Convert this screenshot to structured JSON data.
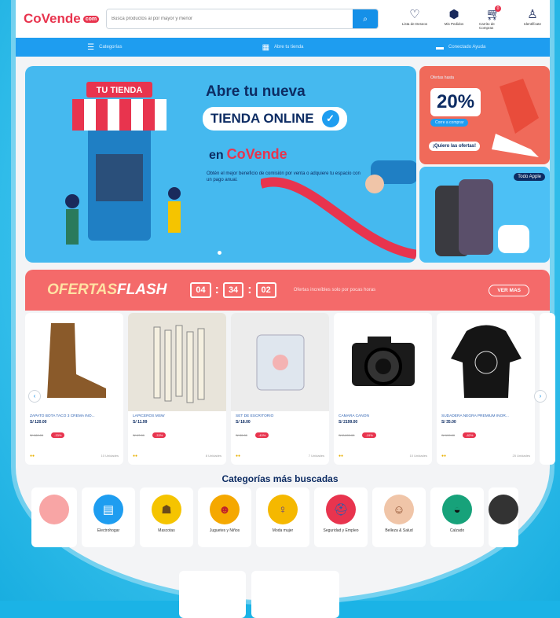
{
  "colors": {
    "brand": "#e8344e",
    "primary": "#1e9df0",
    "navy": "#0d2c63",
    "flash": "#f46a6a"
  },
  "header": {
    "logo": "CoVende",
    "logo_suffix": "com",
    "search": {
      "placeholder": "Busca productos al por mayor y menor",
      "icon": "search-icon"
    },
    "icons": [
      {
        "name": "heart-icon",
        "label": "Lista de Deseos"
      },
      {
        "name": "box-icon",
        "label": "Mis Pedidos"
      },
      {
        "name": "cart-icon",
        "label": "Carrito de Compras",
        "badge": "0"
      },
      {
        "name": "user-icon",
        "label": "Identifícate"
      }
    ]
  },
  "nav": {
    "categories": "Categorías",
    "tienda": "Abre tu tienda",
    "tracking": "Conectado Ayuda"
  },
  "hero": {
    "badge": "TU TIENDA",
    "line1": "Abre tu nueva",
    "line2": "TIENDA ONLINE",
    "en": "en",
    "brand": "CoVende",
    "desc": "Obtén el mejor beneficio de comisión por venta o adquiere tu espacio con un pago anual."
  },
  "side_promo": {
    "pre": "Ofertas hasta",
    "percent": "20%",
    "sub": "Corre a comprar",
    "cta": "¡Quiero las ofertas!"
  },
  "side_apple": {
    "tag": "Todo Apple"
  },
  "flash": {
    "title_a": "OFERTAS",
    "title_b": "FLASH",
    "hh": "04",
    "mm": "34",
    "ss": "02",
    "message": "Ofertas increíbles solo por pocas horas",
    "cta": "VER MAS"
  },
  "products": [
    {
      "name": "ZAPATO BOTA TACO 3 CREMA INO...",
      "price": "S/ 120.00",
      "old": "S/ 180.00",
      "off": "-33%",
      "stock": "10 Unidades"
    },
    {
      "name": "LAPICEROS MSW",
      "price": "S/ 11.99",
      "old": "S/ 17.99",
      "off": "-33%",
      "stock": "8 Unidades"
    },
    {
      "name": "SET DE ESCRITORIO",
      "price": "S/ 18.00",
      "old": "S/ 30.00",
      "off": "-40%",
      "stock": "7 Unidades"
    },
    {
      "name": "CÁMARA CANON",
      "price": "S/ 2199.00",
      "old": "S/ 2,699.00",
      "off": "-19%",
      "stock": "10 Unidades"
    },
    {
      "name": "SUDADERA NEGRA PREMIUM INOR...",
      "price": "S/ 35.00",
      "old": "S/ 199.00",
      "off": "-82%",
      "stock": "25 Unidades"
    }
  ],
  "categories_title": "Categorías más buscadas",
  "categories": [
    {
      "label": "",
      "color": "#f8a5a5",
      "icon": "partial-icon"
    },
    {
      "label": "Electrohogar",
      "color": "#1e9df0",
      "icon": "appliance-icon",
      "glyph": "▤"
    },
    {
      "label": "Mascotas",
      "color": "#f5c400",
      "icon": "pet-icon",
      "glyph": "☗"
    },
    {
      "label": "Juguetes y Niños",
      "color": "#f5a800",
      "icon": "toy-icon",
      "glyph": "☻"
    },
    {
      "label": "Moda mujer",
      "color": "#f5b800",
      "icon": "fashion-icon",
      "glyph": "♀"
    },
    {
      "label": "Seguridad y Empleo",
      "color": "#e8344e",
      "icon": "safety-icon",
      "glyph": "⛑"
    },
    {
      "label": "Belleza & Salud",
      "color": "#f0c5a8",
      "icon": "beauty-icon",
      "glyph": "☺"
    },
    {
      "label": "Calzado",
      "color": "#17a27a",
      "icon": "shoe-icon",
      "glyph": "◒"
    },
    {
      "label": "",
      "color": "#333",
      "icon": "partial-icon"
    }
  ]
}
